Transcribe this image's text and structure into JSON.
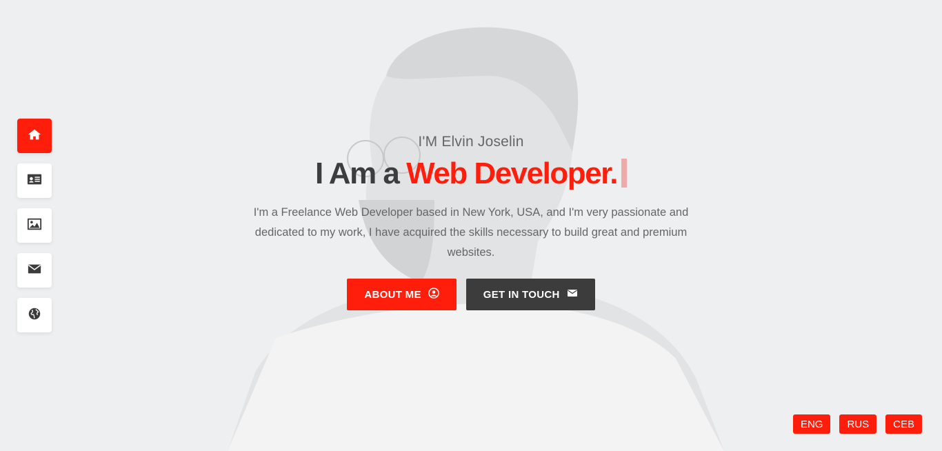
{
  "sidebar": {
    "items": [
      {
        "name": "home",
        "icon": "home-icon",
        "active": true
      },
      {
        "name": "about",
        "icon": "id-card-icon",
        "active": false
      },
      {
        "name": "portfolio",
        "icon": "image-icon",
        "active": false
      },
      {
        "name": "contact",
        "icon": "envelope-icon",
        "active": false
      },
      {
        "name": "blog",
        "icon": "globe-icon",
        "active": false
      }
    ]
  },
  "hero": {
    "intro": "I'M Elvin Joselin",
    "headline_prefix": "I Am a ",
    "headline_accent": "Web Developer.",
    "description": "I'm a Freelance Web Developer based in New York, USA, and I'm very passionate and dedicated to my work, I have acquired the skills necessary to build great and premium websites.",
    "about_button": "ABOUT ME",
    "contact_button": "GET IN TOUCH"
  },
  "languages": [
    "ENG",
    "RUS",
    "CEB"
  ],
  "colors": {
    "accent": "#ff1e0c",
    "dark": "#3c3c3c",
    "background": "#eeeff1"
  }
}
